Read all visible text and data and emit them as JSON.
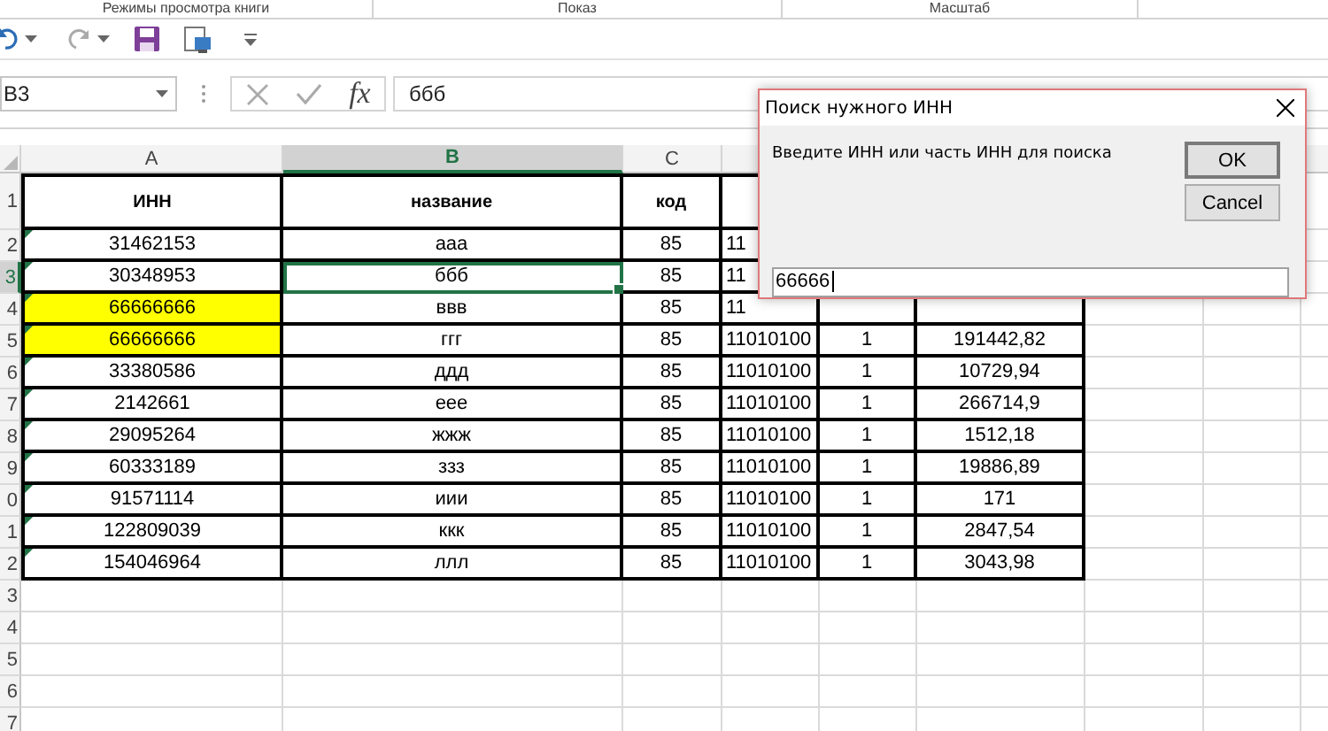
{
  "ribbon_groups": [
    "Режимы просмотра книги",
    "Показ",
    "Масштаб"
  ],
  "formula_bar": {
    "name_box": "B3",
    "function_label": "fx",
    "value": "ббб"
  },
  "columns": [
    {
      "label": "A",
      "selected": false
    },
    {
      "label": "B",
      "selected": true
    },
    {
      "label": "C",
      "selected": false
    }
  ],
  "rows": [
    {
      "label": "1",
      "kind": "header",
      "selected": false,
      "highlighted": false,
      "cells": [
        "ИНН",
        "название",
        "код"
      ]
    },
    {
      "label": "2",
      "kind": "data",
      "selected": false,
      "highlighted": false,
      "cells": [
        "31462153",
        "ааа",
        "85",
        "11"
      ]
    },
    {
      "label": "3",
      "kind": "data",
      "selected": true,
      "highlighted": false,
      "cells": [
        "30348953",
        "ббб",
        "85",
        "11"
      ]
    },
    {
      "label": "4",
      "kind": "data",
      "selected": false,
      "highlighted": true,
      "cells": [
        "66666666",
        "ввв",
        "85",
        "11"
      ]
    },
    {
      "label": "5",
      "kind": "data",
      "selected": false,
      "highlighted": true,
      "cells": [
        "66666666",
        "ггг",
        "85",
        "11010100",
        "1",
        "191442,82"
      ]
    },
    {
      "label": "6",
      "kind": "data",
      "selected": false,
      "highlighted": false,
      "cells": [
        "33380586",
        "ддд",
        "85",
        "11010100",
        "1",
        "10729,94"
      ]
    },
    {
      "label": "7",
      "kind": "data",
      "selected": false,
      "highlighted": false,
      "cells": [
        "2142661",
        "еее",
        "85",
        "11010100",
        "1",
        "266714,9"
      ]
    },
    {
      "label": "8",
      "kind": "data",
      "selected": false,
      "highlighted": false,
      "cells": [
        "29095264",
        "жжж",
        "85",
        "11010100",
        "1",
        "1512,18"
      ]
    },
    {
      "label": "9",
      "kind": "data",
      "selected": false,
      "highlighted": false,
      "cells": [
        "60333189",
        "ззз",
        "85",
        "11010100",
        "1",
        "19886,89"
      ]
    },
    {
      "label": "0",
      "kind": "data",
      "selected": false,
      "highlighted": false,
      "cells": [
        "91571114",
        "иии",
        "85",
        "11010100",
        "1",
        "171"
      ]
    },
    {
      "label": "1",
      "kind": "data",
      "selected": false,
      "highlighted": false,
      "cells": [
        "122809039",
        "ккк",
        "85",
        "11010100",
        "1",
        "2847,54"
      ]
    },
    {
      "label": "2",
      "kind": "data",
      "selected": false,
      "highlighted": false,
      "cells": [
        "154046964",
        "ллл",
        "85",
        "11010100",
        "1",
        "3043,98"
      ]
    },
    {
      "label": "3",
      "kind": "empty",
      "selected": false,
      "cells": []
    },
    {
      "label": "4",
      "kind": "empty",
      "selected": false,
      "cells": []
    },
    {
      "label": "5",
      "kind": "empty",
      "selected": false,
      "cells": []
    },
    {
      "label": "6",
      "kind": "empty",
      "selected": false,
      "cells": []
    },
    {
      "label": "7",
      "kind": "empty",
      "selected": false,
      "cells": []
    }
  ],
  "dialog": {
    "title": "Поиск нужного ИНН",
    "message": "Введите ИНН или часть ИНН для поиска",
    "input_value": "66666",
    "buttons": [
      {
        "label": "OK",
        "default": true
      },
      {
        "label": "Cancel",
        "default": false
      }
    ]
  }
}
